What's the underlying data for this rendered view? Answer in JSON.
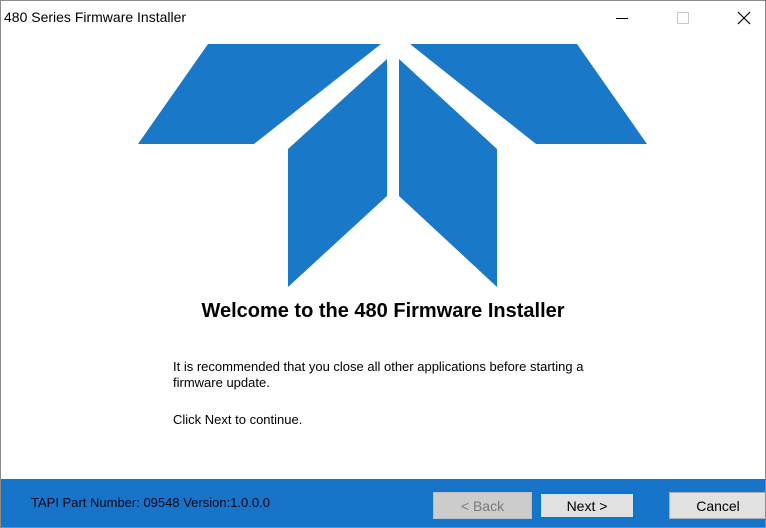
{
  "window": {
    "title": "480 Series Firmware Installer",
    "controls": [
      "minimize-icon",
      "maximize-icon",
      "close-icon"
    ]
  },
  "logo": {
    "icon": "teledyne-logo-icon",
    "color": "#1a78c8"
  },
  "content": {
    "heading": "Welcome to the 480 Firmware Installer",
    "message": "It is recommended that you close all other applications before starting a firmware update.",
    "instruction": "Click Next to continue."
  },
  "footer": {
    "part_info": "TAPI Part Number: 09548  Version:1.0.0.0",
    "background": "#1874c8",
    "buttons": {
      "back": "< Back",
      "next": "Next >",
      "cancel": "Cancel"
    }
  }
}
